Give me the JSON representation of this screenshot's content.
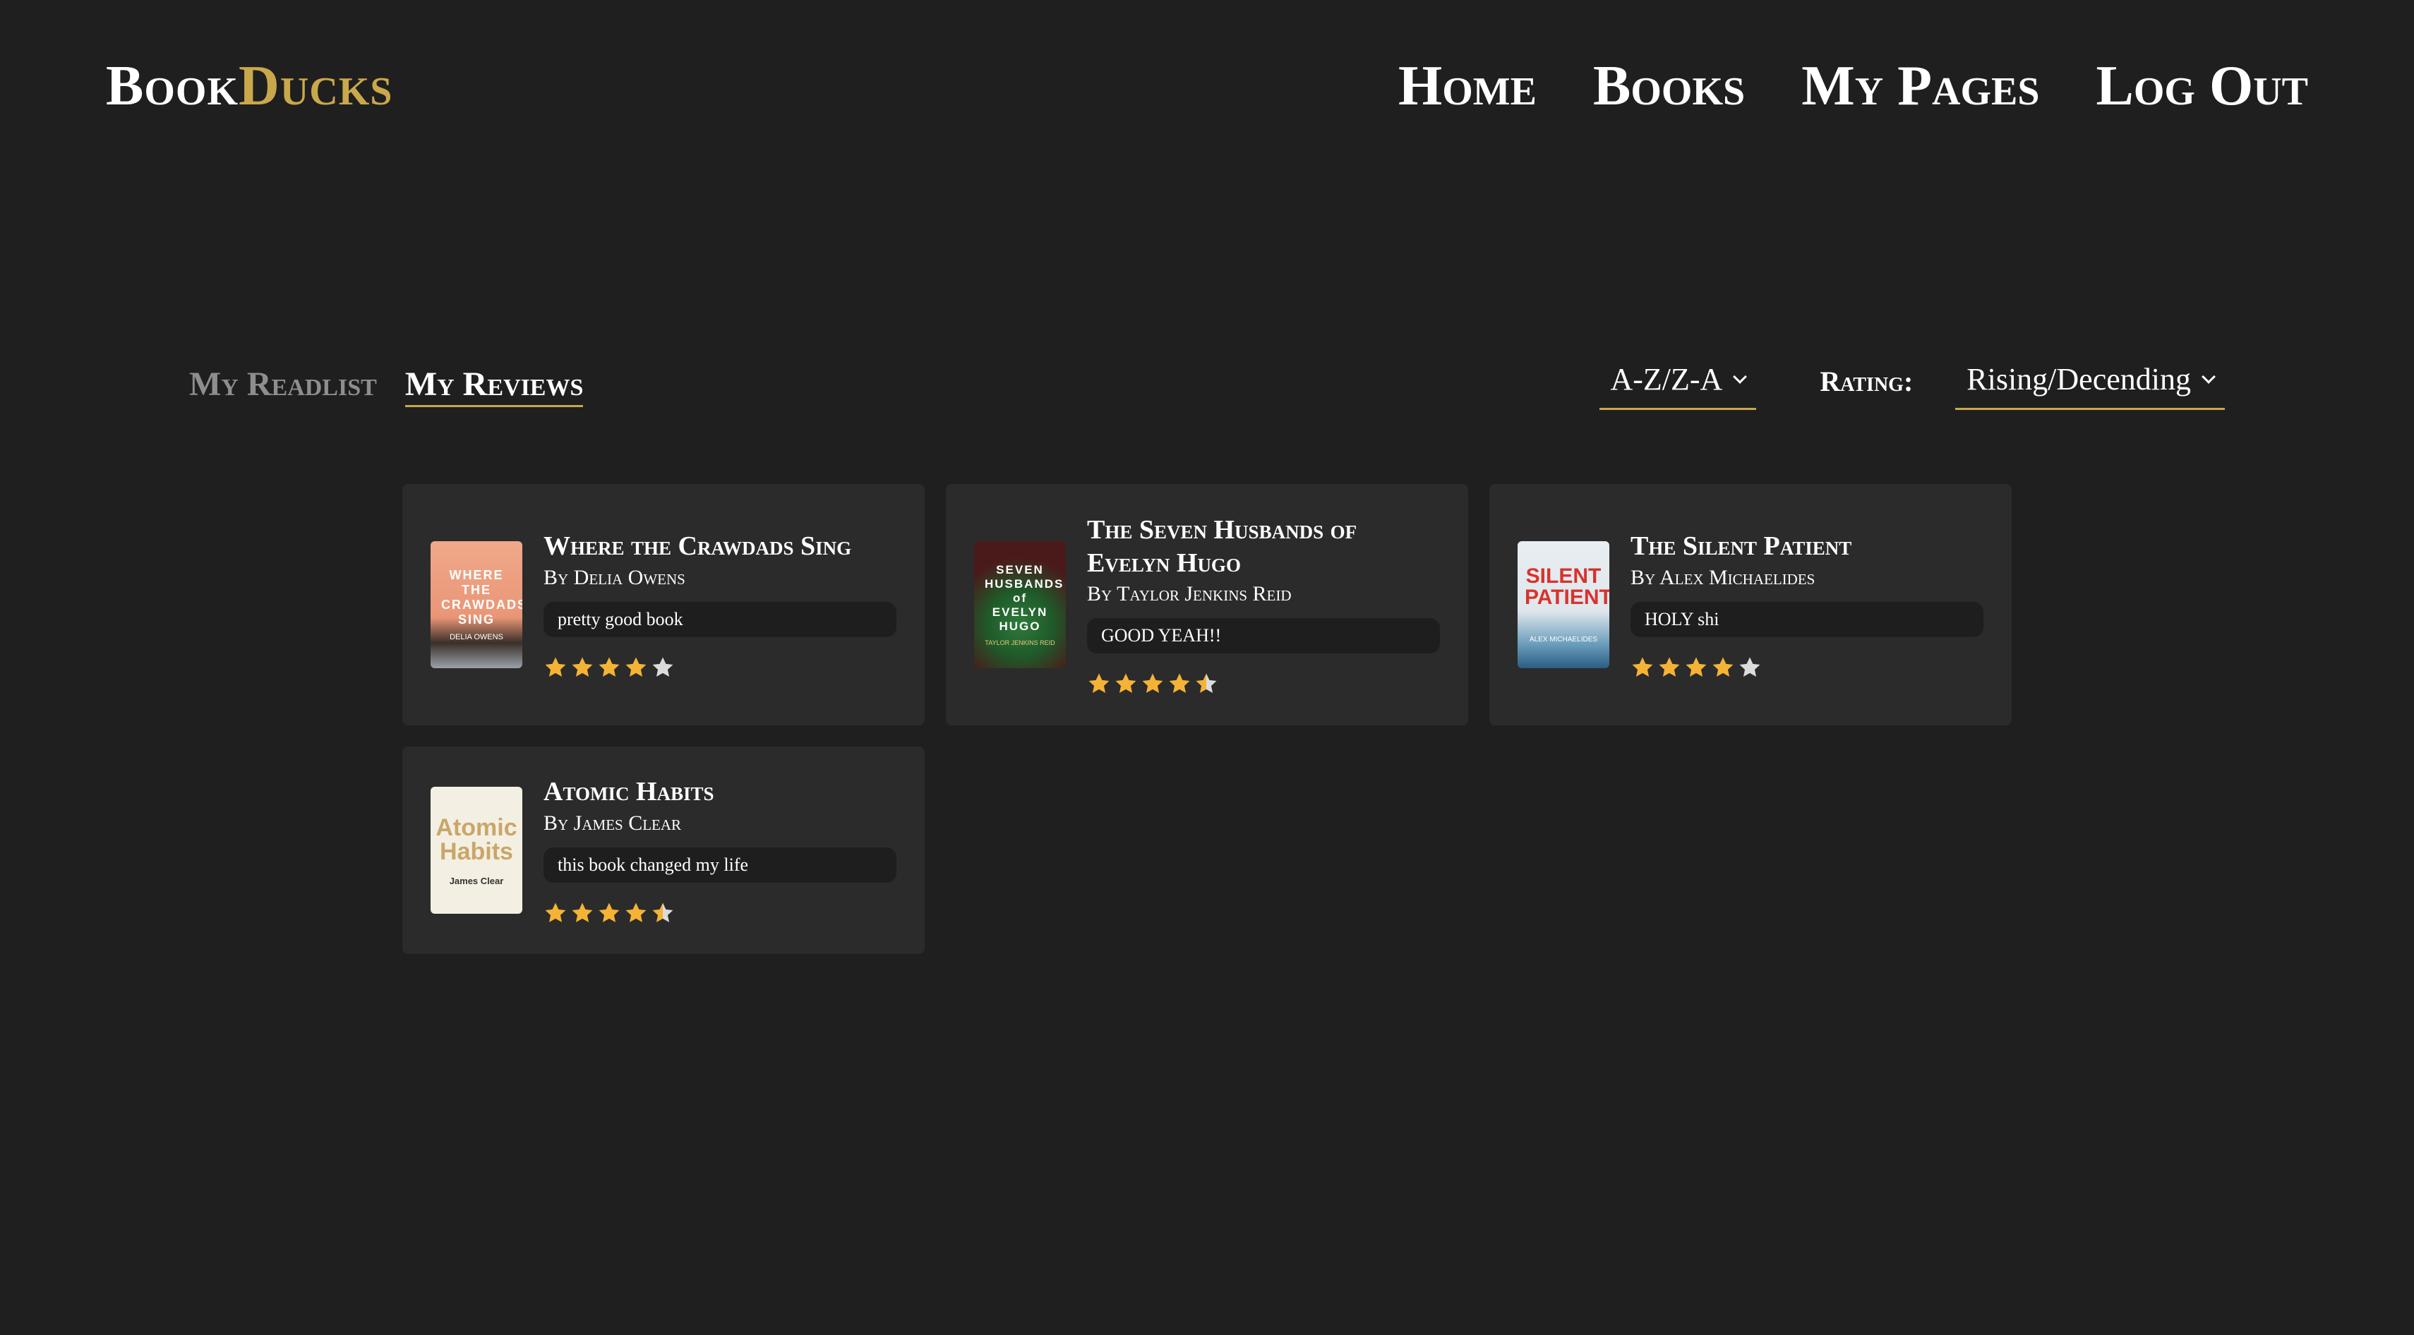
{
  "header": {
    "logo_main": "Book",
    "logo_accent": "Ducks",
    "nav": [
      "Home",
      "Books",
      "My Pages",
      "Log Out"
    ]
  },
  "tabs": [
    {
      "label": "My Readlist",
      "active": false
    },
    {
      "label": "My Reviews",
      "active": true
    }
  ],
  "filters": {
    "sort_value": "A-Z/Z-A",
    "rating_label": "Rating:",
    "rating_value": "Rising/Decending"
  },
  "colors": {
    "accent": "#c9a84c",
    "background": "#1f1f1f",
    "card": "#2b2b2b",
    "star_filled": "#f5b335",
    "star_empty": "#dcdcdc"
  },
  "reviews": [
    {
      "title": "Where the Crawdads Sing",
      "author": "By Delia Owens",
      "review": "pretty good book",
      "rating": 4,
      "cover_text": "WHERE THE CRAWDADS SING",
      "cover_author": "DELIA OWENS"
    },
    {
      "title": "The Seven Husbands of Evelyn Hugo",
      "author": "By Taylor Jenkins Reid",
      "review": "GOOD YEAH!!",
      "rating": 4.5,
      "cover_text": "SEVEN HUSBANDS of EVELYN HUGO",
      "cover_author": "TAYLOR JENKINS REID"
    },
    {
      "title": "The Silent Patient",
      "author": "By Alex Michaelides",
      "review": "HOLY shi",
      "rating": 4,
      "cover_text": "SILENT PATIENT",
      "cover_author": "ALEX MICHAELIDES"
    },
    {
      "title": "Atomic Habits",
      "author": "By James Clear",
      "review": "this book changed my life",
      "rating": 4.5,
      "cover_text": "Atomic Habits",
      "cover_author": "James Clear"
    }
  ]
}
